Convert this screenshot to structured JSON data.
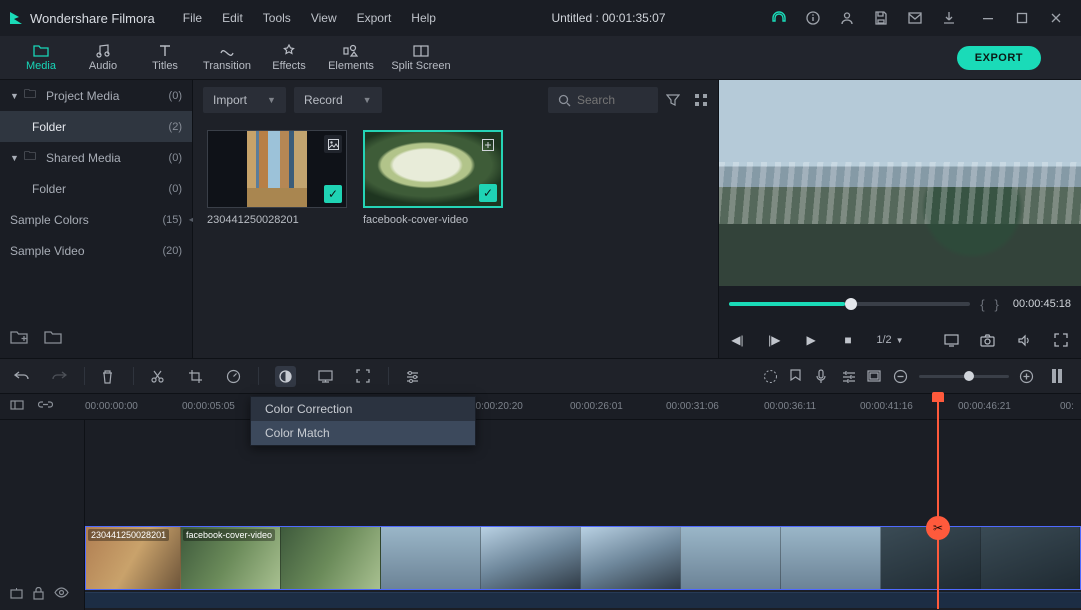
{
  "app": {
    "name": "Wondershare Filmora"
  },
  "menu": [
    "File",
    "Edit",
    "Tools",
    "View",
    "Export",
    "Help"
  ],
  "title": "Untitled : 00:01:35:07",
  "toolTabs": [
    {
      "label": "Media",
      "icon": "folder-icon"
    },
    {
      "label": "Audio",
      "icon": "music-icon"
    },
    {
      "label": "Titles",
      "icon": "text-icon"
    },
    {
      "label": "Transition",
      "icon": "transition-icon"
    },
    {
      "label": "Effects",
      "icon": "effects-icon"
    },
    {
      "label": "Elements",
      "icon": "elements-icon"
    },
    {
      "label": "Split Screen",
      "icon": "splitscreen-icon"
    }
  ],
  "exportLabel": "EXPORT",
  "sidebar": {
    "items": [
      {
        "label": "Project Media",
        "count": "(0)",
        "tri": "▼",
        "icon": "🗀"
      },
      {
        "label": "Folder",
        "count": "(2)",
        "child": true,
        "sel": true
      },
      {
        "label": "Shared Media",
        "count": "(0)",
        "tri": "▼",
        "icon": "🗀"
      },
      {
        "label": "Folder",
        "count": "(0)",
        "child": true
      },
      {
        "label": "Sample Colors",
        "count": "(15)"
      },
      {
        "label": "Sample Video",
        "count": "(20)"
      }
    ]
  },
  "mediaBar": {
    "import": "Import",
    "record": "Record",
    "searchPlaceholder": "Search"
  },
  "thumbs": [
    {
      "caption": "230441250028201"
    },
    {
      "caption": "facebook-cover-video",
      "sel": true
    }
  ],
  "preview": {
    "time": "00:00:45:18",
    "speed": "1/2"
  },
  "ruler": {
    "ticks": [
      "00:00:00:00",
      "00:00:05:05",
      "00:00:20:20",
      "00:00:26:01",
      "00:00:31:06",
      "00:00:36:11",
      "00:00:41:16",
      "00:00:46:21",
      "00:"
    ],
    "tickPos": [
      85,
      182,
      470,
      570,
      666,
      764,
      860,
      958,
      1060
    ],
    "leftIcons": [
      "crop-icon",
      "link-icon"
    ]
  },
  "contextMenu": {
    "items": [
      "Color Correction",
      "Color Match"
    ],
    "hoverIndex": 1
  },
  "clipLabels": [
    "230441250028201",
    "facebook-cover-video"
  ]
}
